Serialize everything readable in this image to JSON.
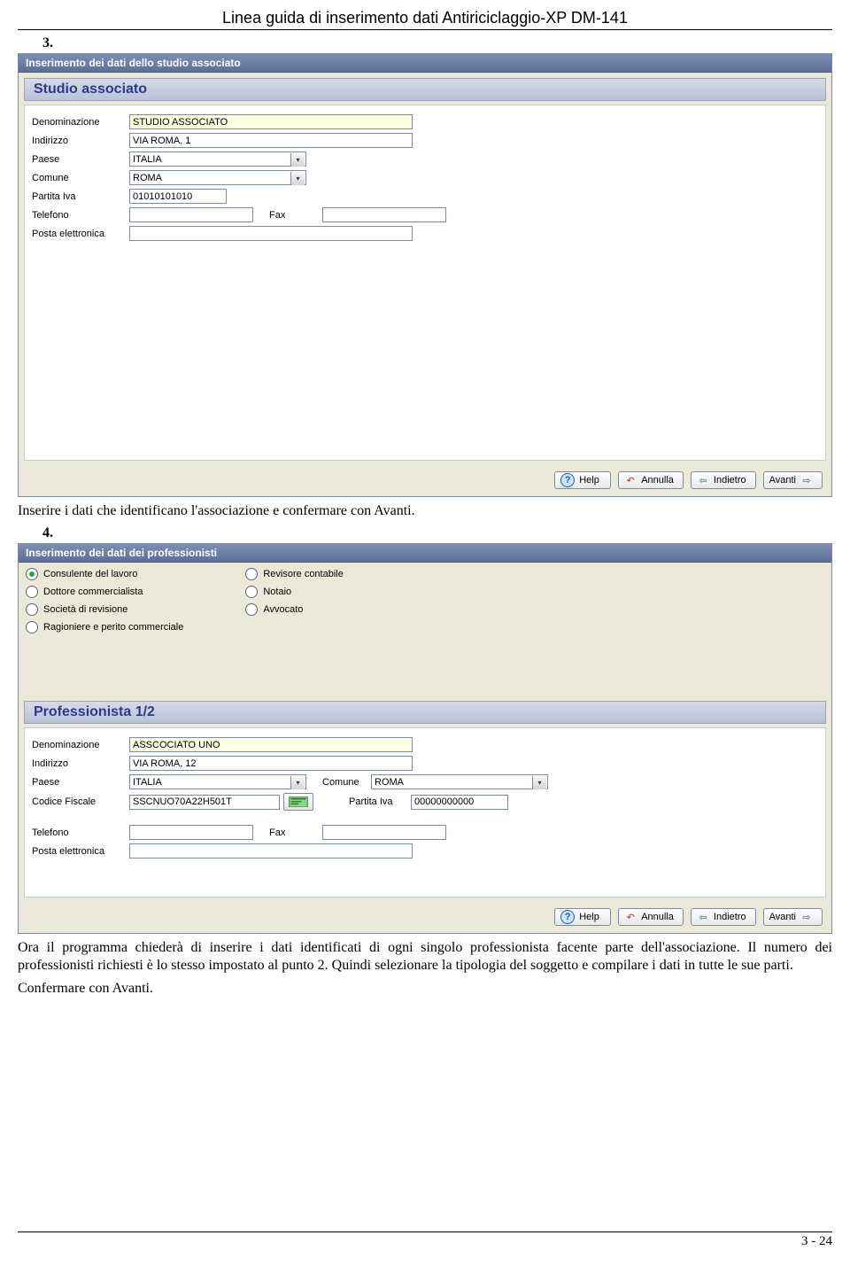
{
  "doc_title": "Linea guida di inserimento dati Antiriciclaggio-XP DM-141",
  "step3": "3.",
  "step4": "4.",
  "window1": {
    "title": "Inserimento dei dati dello studio associato",
    "section": "Studio associato",
    "fields": {
      "denominazione_label": "Denominazione",
      "denominazione_value": "STUDIO ASSOCIATO",
      "indirizzo_label": "Indirizzo",
      "indirizzo_value": "VIA ROMA, 1",
      "paese_label": "Paese",
      "paese_value": "ITALIA",
      "comune_label": "Comune",
      "comune_value": "ROMA",
      "piva_label": "Partita Iva",
      "piva_value": "01010101010",
      "telefono_label": "Telefono",
      "telefono_value": "",
      "fax_label": "Fax",
      "fax_value": "",
      "email_label": "Posta elettronica",
      "email_value": ""
    }
  },
  "buttons": {
    "help": "Help",
    "annulla": "Annulla",
    "indietro": "Indietro",
    "avanti": "Avanti"
  },
  "para1": "Inserire i dati che identificano l'associazione e confermare con Avanti.",
  "window2": {
    "title": "Inserimento dei dati dei professionisti",
    "radios_left": [
      "Consulente del lavoro",
      "Dottore commercialista",
      "Società di revisione",
      "Ragioniere e perito commerciale"
    ],
    "radios_right": [
      "Revisore contabile",
      "Notaio",
      "Avvocato"
    ],
    "selected_radio": "Consulente del lavoro",
    "section": "Professionista 1/2",
    "fields": {
      "denominazione_label": "Denominazione",
      "denominazione_value": "ASSCOCIATO UNO",
      "indirizzo_label": "Indirizzo",
      "indirizzo_value": "VIA ROMA, 12",
      "paese_label": "Paese",
      "paese_value": "ITALIA",
      "comune_label": "Comune",
      "comune_value": "ROMA",
      "cf_label": "Codice Fiscale",
      "cf_value": "SSCNUO70A22H501T",
      "piva_label": "Partita Iva",
      "piva_value": "00000000000",
      "telefono_label": "Telefono",
      "telefono_value": "",
      "fax_label": "Fax",
      "fax_value": "",
      "email_label": "Posta elettronica",
      "email_value": ""
    }
  },
  "para2": "Ora il programma chiederà di inserire i dati identificati di ogni singolo professionista facente parte dell'associazione. Il numero dei professionisti richiesti è lo stesso impostato al punto 2. Quindi selezionare la tipologia del soggetto e compilare i dati in tutte le sue parti.",
  "para3": "Confermare con Avanti.",
  "page_number": "3 - 24"
}
